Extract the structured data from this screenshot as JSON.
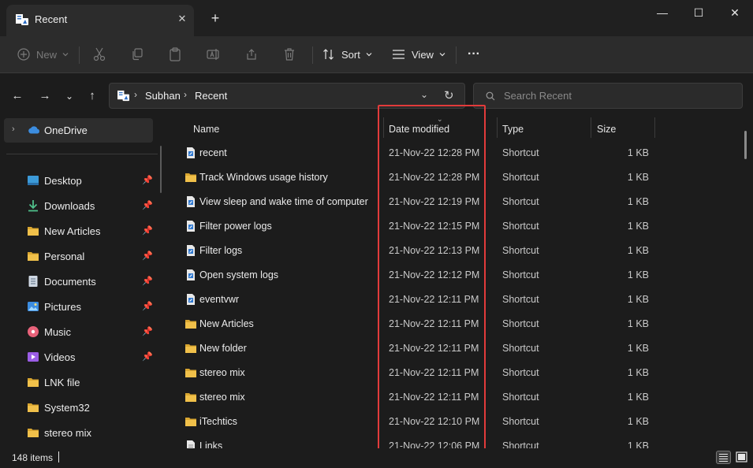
{
  "window": {
    "tab_title": "Recent",
    "tab_close": "✕",
    "new_tab": "+",
    "minimize": "—",
    "maximize": "☐",
    "close": "✕"
  },
  "toolbar": {
    "new_label": "New",
    "sort_label": "Sort",
    "view_label": "View",
    "more_label": "···"
  },
  "address": {
    "crumbs": [
      "Subhan",
      "Recent"
    ]
  },
  "search": {
    "placeholder": "Search Recent"
  },
  "sidebar": {
    "onedrive_label": "OneDrive",
    "items": [
      {
        "label": "Desktop",
        "icon": "desktop-icon",
        "pinned": true
      },
      {
        "label": "Downloads",
        "icon": "download-icon",
        "pinned": true
      },
      {
        "label": "New Articles",
        "icon": "folder-icon",
        "pinned": true
      },
      {
        "label": "Personal",
        "icon": "folder-icon",
        "pinned": true
      },
      {
        "label": "Documents",
        "icon": "documents-icon",
        "pinned": true
      },
      {
        "label": "Pictures",
        "icon": "pictures-icon",
        "pinned": true
      },
      {
        "label": "Music",
        "icon": "music-icon",
        "pinned": true
      },
      {
        "label": "Videos",
        "icon": "videos-icon",
        "pinned": true
      },
      {
        "label": "LNK file",
        "icon": "folder-icon",
        "pinned": false
      },
      {
        "label": "System32",
        "icon": "folder-icon",
        "pinned": false
      },
      {
        "label": "stereo mix",
        "icon": "folder-icon",
        "pinned": false
      }
    ]
  },
  "columns": {
    "name": "Name",
    "date": "Date modified",
    "type": "Type",
    "size": "Size"
  },
  "files": [
    {
      "name": "recent",
      "date": "21-Nov-22 12:28 PM",
      "type": "Shortcut",
      "size": "1 KB",
      "icon": "shortcut-doc-icon"
    },
    {
      "name": "Track Windows usage history",
      "date": "21-Nov-22 12:28 PM",
      "type": "Shortcut",
      "size": "1 KB",
      "icon": "folder-icon"
    },
    {
      "name": "View sleep and wake time of computer",
      "date": "21-Nov-22 12:19 PM",
      "type": "Shortcut",
      "size": "1 KB",
      "icon": "shortcut-doc-icon"
    },
    {
      "name": "Filter power logs",
      "date": "21-Nov-22 12:15 PM",
      "type": "Shortcut",
      "size": "1 KB",
      "icon": "shortcut-doc-icon"
    },
    {
      "name": "Filter logs",
      "date": "21-Nov-22 12:13 PM",
      "type": "Shortcut",
      "size": "1 KB",
      "icon": "shortcut-doc-icon"
    },
    {
      "name": "Open system logs",
      "date": "21-Nov-22 12:12 PM",
      "type": "Shortcut",
      "size": "1 KB",
      "icon": "shortcut-doc-icon"
    },
    {
      "name": "eventvwr",
      "date": "21-Nov-22 12:11 PM",
      "type": "Shortcut",
      "size": "1 KB",
      "icon": "shortcut-doc-icon"
    },
    {
      "name": "New Articles",
      "date": "21-Nov-22 12:11 PM",
      "type": "Shortcut",
      "size": "1 KB",
      "icon": "folder-icon"
    },
    {
      "name": "New folder",
      "date": "21-Nov-22 12:11 PM",
      "type": "Shortcut",
      "size": "1 KB",
      "icon": "folder-icon"
    },
    {
      "name": "stereo mix",
      "date": "21-Nov-22 12:11 PM",
      "type": "Shortcut",
      "size": "1 KB",
      "icon": "folder-icon"
    },
    {
      "name": "stereo mix",
      "date": "21-Nov-22 12:11 PM",
      "type": "Shortcut",
      "size": "1 KB",
      "icon": "folder-icon"
    },
    {
      "name": "iTechtics",
      "date": "21-Nov-22 12:10 PM",
      "type": "Shortcut",
      "size": "1 KB",
      "icon": "folder-icon"
    },
    {
      "name": "Links",
      "date": "21-Nov-22 12:06 PM",
      "type": "Shortcut",
      "size": "1 KB",
      "icon": "shortcut-file-icon"
    }
  ],
  "status": {
    "item_count": "148 items"
  },
  "colors": {
    "highlight": "#e23b3b",
    "folder": "#f0c04a",
    "accent": "#4aa3ff"
  }
}
